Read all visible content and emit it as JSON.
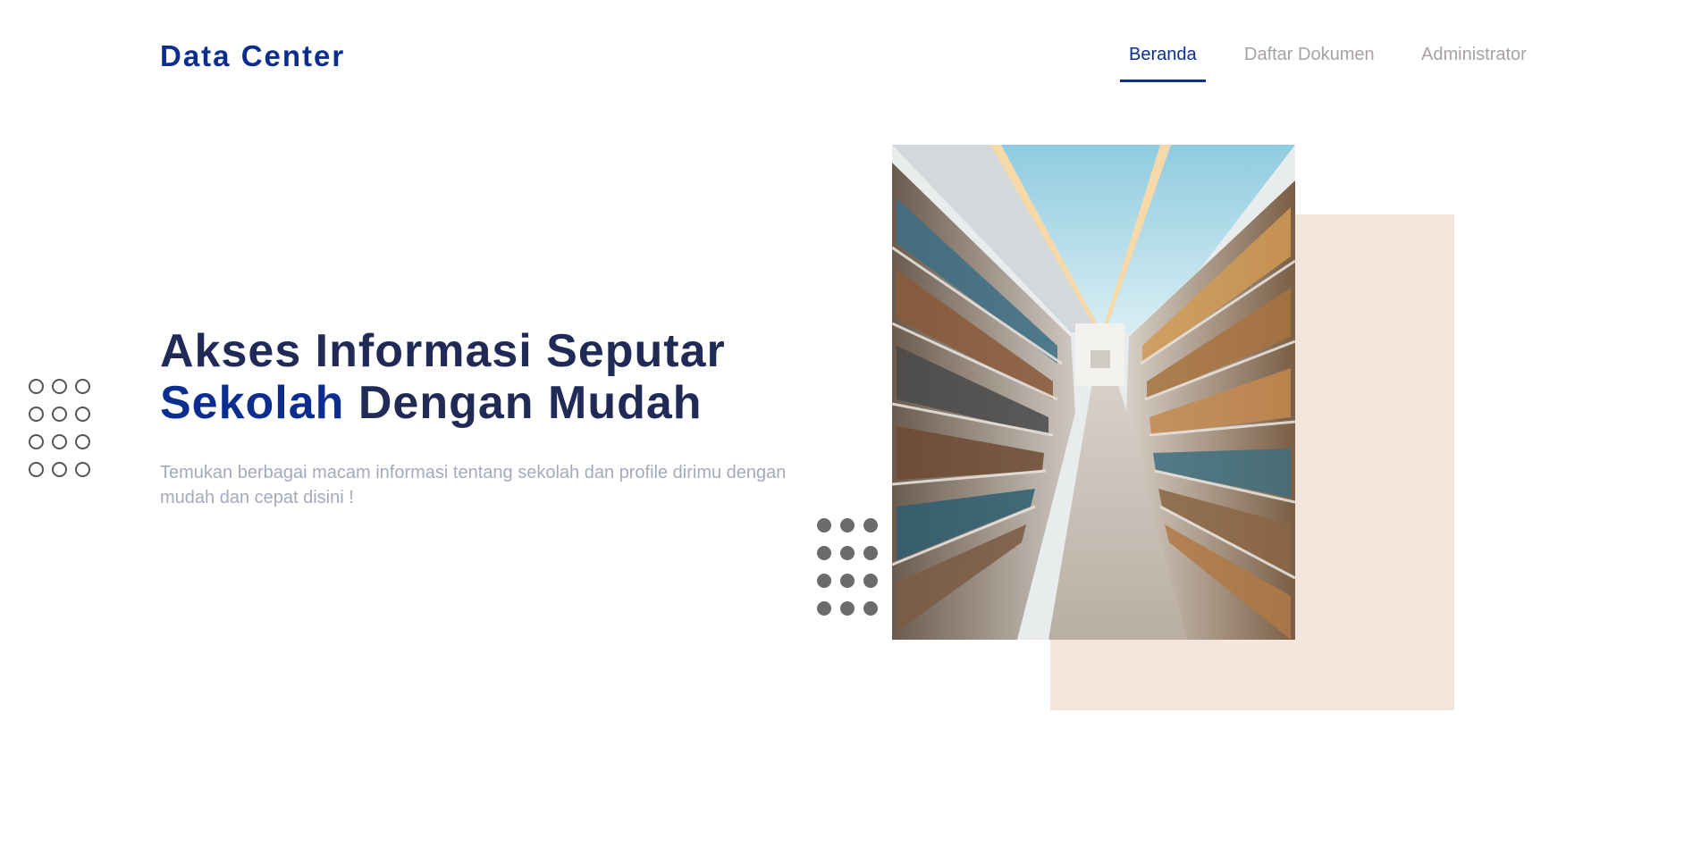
{
  "header": {
    "brand": "Data Center",
    "nav": [
      {
        "label": "Beranda",
        "active": true
      },
      {
        "label": "Daftar Dokumen",
        "active": false
      },
      {
        "label": "Administrator",
        "active": false
      }
    ]
  },
  "hero": {
    "title_line1": "Akses Informasi Seputar",
    "title_accent": "Sekolah",
    "title_line2_rest": "Dengan Mudah",
    "subtitle": "Temukan berbagai macam informasi tentang sekolah dan profile dirimu dengan mudah dan cepat disini !",
    "image_icon": "library-bookshelves-image"
  },
  "colors": {
    "brand": "#0a2d8f",
    "heading": "#1f2a56",
    "muted_text": "#a5a9bd",
    "nav_inactive": "#a8a2a2",
    "beige": "#f4e6dd",
    "dots": "#6b6b6b"
  }
}
